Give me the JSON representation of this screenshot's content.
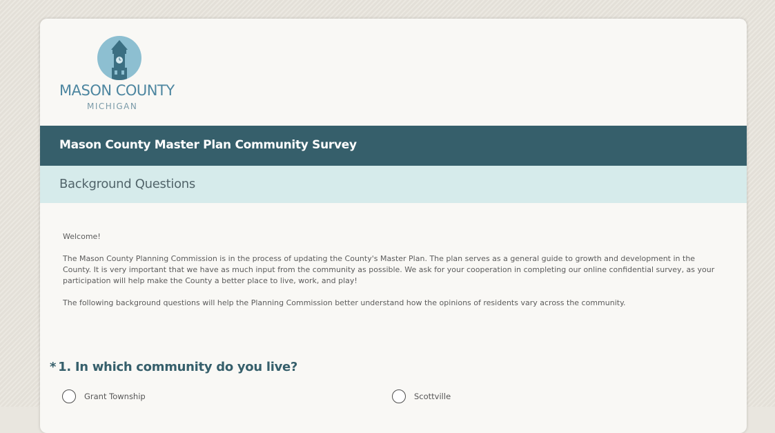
{
  "logo": {
    "name": "MASON COUNTY",
    "state": "MICHIGAN"
  },
  "survey": {
    "title": "Mason County Master Plan Community Survey",
    "page_title": "Background Questions"
  },
  "intro": {
    "welcome": "Welcome!",
    "paragraph1": "The Mason County Planning Commission is in the process of updating the County's Master Plan. The plan serves as a general guide to growth and development in the County. It is very important that we have as much input from the community as possible. We ask for your cooperation in completing our online confidential survey, as your participation will help make the County a better place to live, work, and play!",
    "paragraph2": "The following background questions will help the Planning Commission better understand how the opinions of residents vary across the community."
  },
  "question1": {
    "required_marker": "*",
    "text": "1. In which community do you live?",
    "options": [
      "Grant Township",
      "Scottville"
    ]
  },
  "colors": {
    "title_bar": "#365f6b",
    "page_bar": "#d6ebeb",
    "question_text": "#365f6b",
    "logo_circle": "#8dbfd1"
  },
  "icons": [
    "clock-tower-icon",
    "radio-button-icon"
  ]
}
